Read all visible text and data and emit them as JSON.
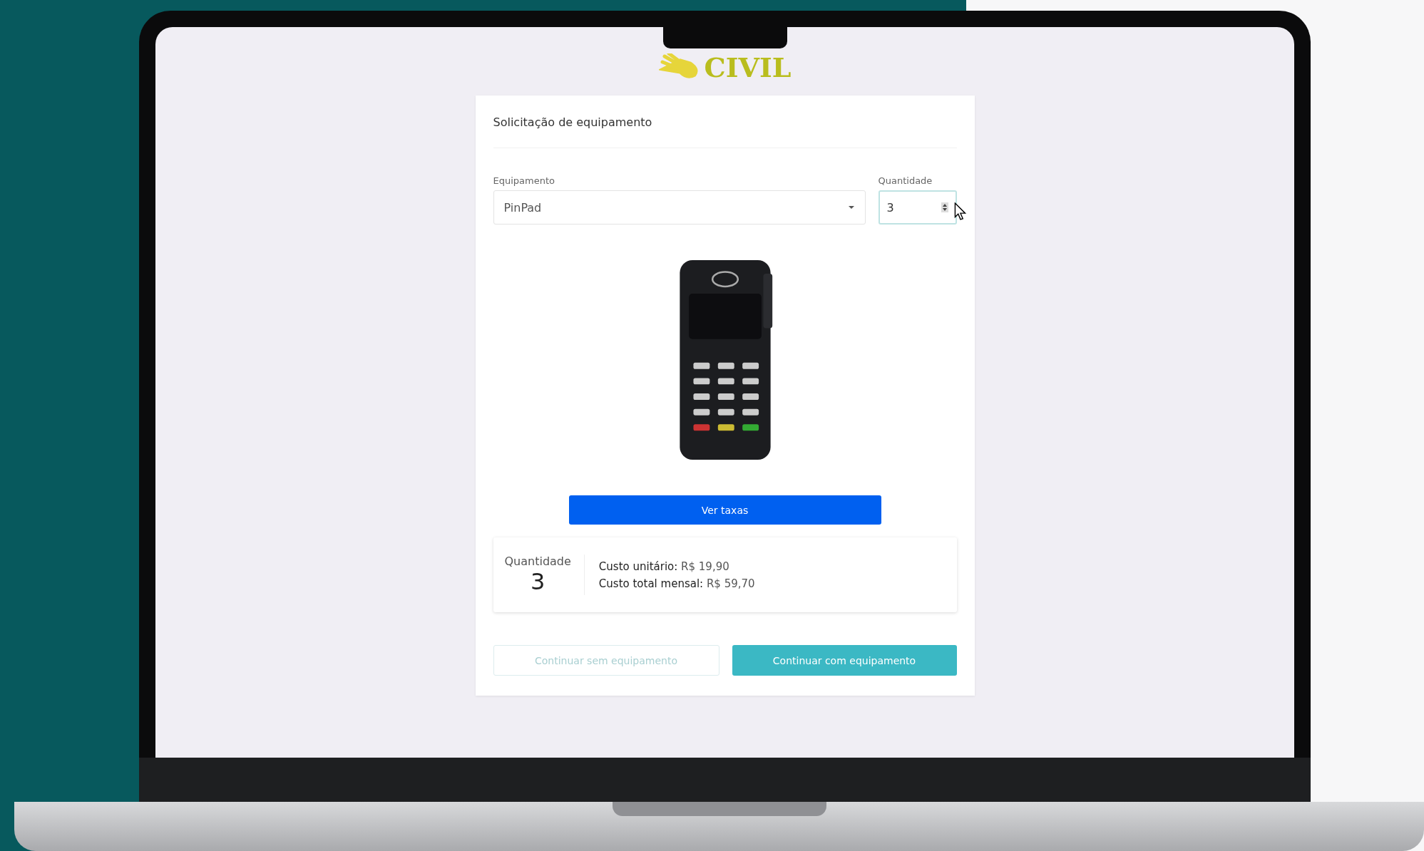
{
  "logo": {
    "text": "CIVIL"
  },
  "card": {
    "title": "Solicitação de equipamento",
    "equipment": {
      "label": "Equipamento",
      "value": "PinPad"
    },
    "quantity": {
      "label": "Quantidade",
      "value": "3"
    },
    "rates_button": "Ver taxas",
    "summary": {
      "label": "Quantidade",
      "value": "3",
      "lines": [
        {
          "label": "Custo unitário:",
          "value": "R$ 19,90"
        },
        {
          "label": "Custo total mensal:",
          "value": "R$ 59,70"
        }
      ]
    },
    "actions": [
      {
        "label": "Continuar sem equipamento",
        "kind": "outline"
      },
      {
        "label": "Continuar com equipamento",
        "kind": "primary"
      }
    ]
  }
}
